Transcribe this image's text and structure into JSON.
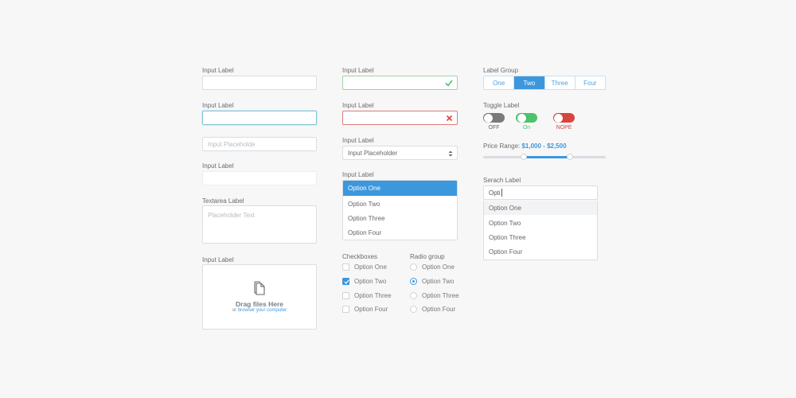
{
  "column1": {
    "field1_label": "Input Label",
    "field2_label": "Input Label",
    "field3_placeholder": "Input Placeholde",
    "field4_label": "Input Label",
    "textarea_label": "Textarea Label",
    "textarea_placeholder": "Placeholder Text",
    "upload_label": "Input Label",
    "upload_title": "Drag files Here",
    "upload_sub_prefix": "or",
    "upload_sub_link": "browser your computer"
  },
  "column2": {
    "valid_label": "Input Label",
    "error_label": "Input Label",
    "select_label": "Input Label",
    "select_value": "Input Placeholder",
    "dropdown_label": "Input Label",
    "dropdown_options": [
      "Option One",
      "Option Two",
      "Option Three",
      "Option Four"
    ],
    "dropdown_selected": "Option One",
    "checkboxes_label": "Checkboxes",
    "checkboxes": [
      {
        "label": "Option One",
        "checked": false
      },
      {
        "label": "Option Two",
        "checked": true
      },
      {
        "label": "Option Three",
        "checked": false
      },
      {
        "label": "Option Four",
        "checked": false
      }
    ],
    "radio_label": "Radio group",
    "radios": [
      {
        "label": "Option One",
        "checked": false
      },
      {
        "label": "Option Two",
        "checked": true
      },
      {
        "label": "Option Three",
        "checked": false
      },
      {
        "label": "Option Four",
        "checked": false
      }
    ]
  },
  "column3": {
    "label_group_label": "Label Group",
    "segments": [
      "One",
      "Two",
      "Three",
      "Four"
    ],
    "segment_active": "Two",
    "toggle_label": "Toggle Label",
    "toggles": [
      {
        "label": "OFF",
        "state": "off",
        "color": "#7a7a7a"
      },
      {
        "label": "On",
        "state": "on",
        "color": "#4cc46b"
      },
      {
        "label": "NOPE",
        "state": "nope",
        "color": "#d9453d"
      }
    ],
    "price_label": "Price Range:",
    "price_value": "$1,000 - $2,500",
    "range_low_fraction": 0.33,
    "range_high_fraction": 0.71,
    "search_label": "Serach Label",
    "search_value": "Opti",
    "search_options": [
      "Option One",
      "Option Two",
      "Option Three",
      "Option Four"
    ],
    "search_highlighted": "Option One"
  },
  "colors": {
    "accent": "#3d97dc",
    "valid": "#4cc46b",
    "error": "#d9453d"
  }
}
